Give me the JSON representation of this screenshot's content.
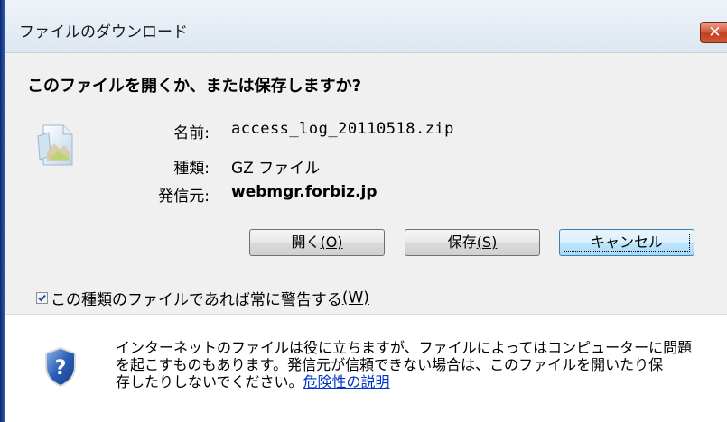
{
  "window": {
    "title": "ファイルのダウンロード",
    "close_label": "✕"
  },
  "dialog": {
    "question": "このファイルを開くか、または保存しますか?",
    "fields": {
      "name_label": "名前:",
      "name_value": "access_log_20110518.zip",
      "type_label": "種類:",
      "type_value": "GZ ファイル",
      "from_label": "発信元:",
      "from_value": "webmgr.forbiz.jp"
    },
    "buttons": {
      "open_label": "開く",
      "open_accel": "(O)",
      "save_label": "保存",
      "save_accel": "(S)",
      "cancel_label": "キャンセル"
    },
    "checkbox": {
      "checked": true,
      "label": "この種類のファイルであれば常に警告する",
      "accel": "(W)"
    }
  },
  "footer": {
    "warning_line1": "インターネットのファイルは役に立ちますが、ファイルによってはコンピューターに問題",
    "warning_line2": "を起こすものもあります。発信元が信頼できない場合は、このファイルを開いたり保",
    "warning_line3": "存したりしないでください。",
    "link_text": "危険性の説明"
  },
  "colors": {
    "title_bar": "#dde7f1",
    "close_button": "#c1401f",
    "body_panel": "#f0f0f0",
    "default_button": "#bee6fd",
    "link": "#0033cc",
    "shield": "#2a5fb8"
  },
  "icons": {
    "file": "file-icon",
    "shield": "shield-question-icon",
    "close": "close-icon",
    "check": "check-icon"
  }
}
